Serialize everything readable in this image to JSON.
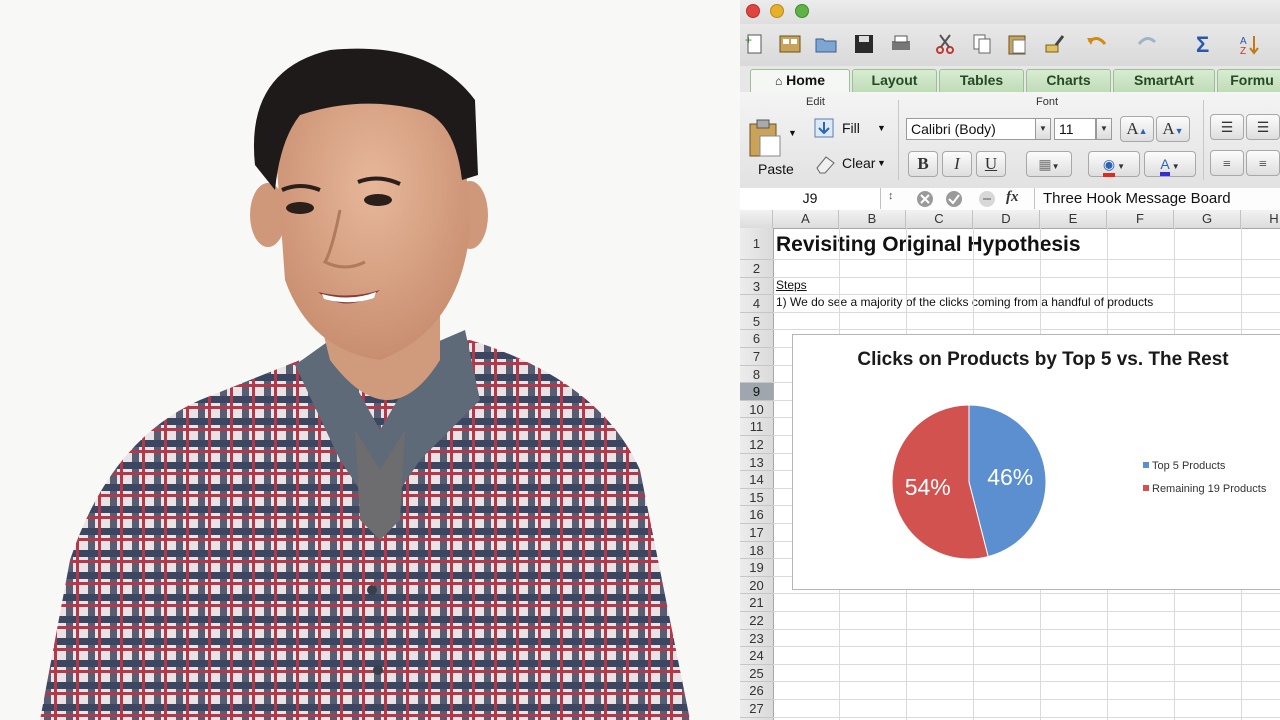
{
  "window_controls": {
    "close": "close",
    "minimize": "minimize",
    "zoom": "zoom"
  },
  "toolbar": {
    "icons": [
      "new-icon",
      "gallery-icon",
      "open-icon",
      "save-icon",
      "print-icon",
      "cut-icon",
      "copy-icon",
      "paste-icon",
      "format-painter-icon",
      "undo-icon",
      "redo-icon",
      "autosum-icon",
      "sort-icon"
    ]
  },
  "ribbon_tabs": [
    "Home",
    "Layout",
    "Tables",
    "Charts",
    "SmartArt",
    "Formu"
  ],
  "ribbon": {
    "edit_group": "Edit",
    "font_group": "Font",
    "paste_label": "Paste",
    "fill_label": "Fill",
    "clear_label": "Clear",
    "font_name": "Calibri (Body)",
    "font_size": "11",
    "bold": "B",
    "italic": "I",
    "underline": "U",
    "grow_font": "A",
    "shrink_font": "A"
  },
  "formula_bar": {
    "cell_ref": "J9",
    "fx": "fx",
    "value": "Three Hook Message Board"
  },
  "columns": [
    "A",
    "B",
    "C",
    "D",
    "E",
    "F",
    "G",
    "H"
  ],
  "rows": [
    "1",
    "2",
    "3",
    "4",
    "5",
    "6",
    "7",
    "8",
    "9",
    "10",
    "11",
    "12",
    "13",
    "14",
    "15",
    "16",
    "17",
    "18",
    "19",
    "20",
    "21",
    "22",
    "23",
    "24",
    "25",
    "26",
    "27"
  ],
  "cells": {
    "A1": "Revisiting Original Hypothesis",
    "A3": "Steps",
    "A4": "1) We do see a majority of the clicks coming from a handful of products"
  },
  "chart_data": {
    "type": "pie",
    "title": "Clicks on Products by Top 5 vs. The Rest",
    "labels": [
      "Top 5 Products",
      "Remaining 19 Products"
    ],
    "values": [
      46,
      54
    ],
    "data_labels": [
      "46%",
      "54%"
    ],
    "colors": [
      "#5b8fd0",
      "#d1524f"
    ],
    "legend_position": "right"
  }
}
